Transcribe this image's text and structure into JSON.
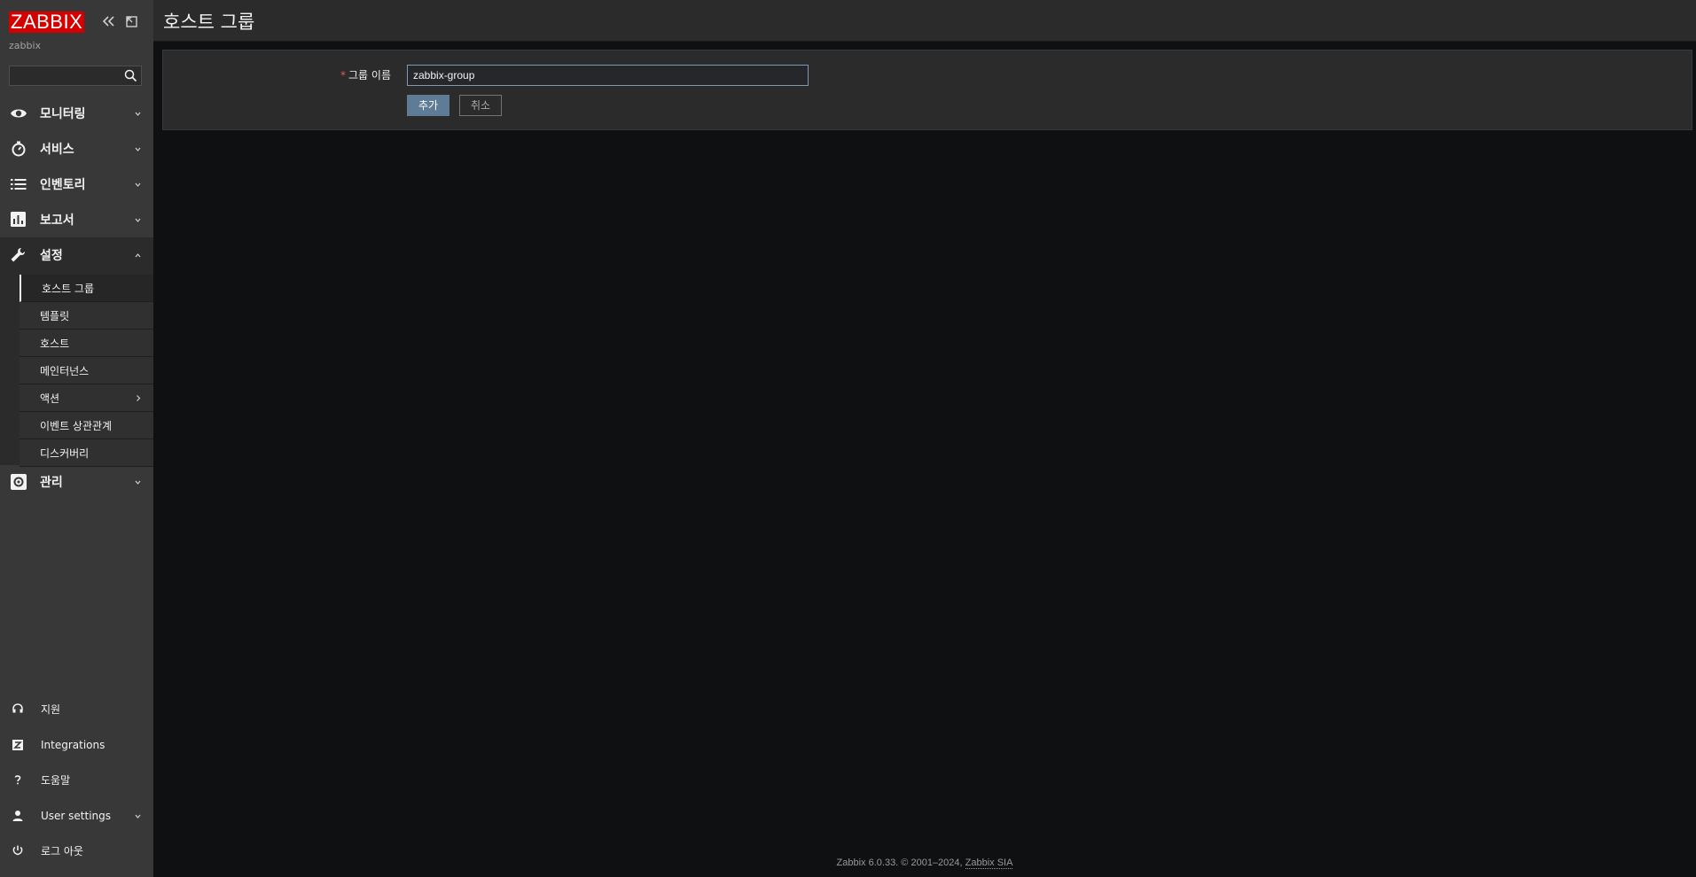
{
  "sidebar": {
    "logo_text": "ZABBIX",
    "server_name": "zabbix",
    "search_placeholder": "",
    "menu": [
      {
        "label": "모니터링",
        "icon": "eye-icon"
      },
      {
        "label": "서비스",
        "icon": "stopwatch-icon"
      },
      {
        "label": "인벤토리",
        "icon": "list-icon"
      },
      {
        "label": "보고서",
        "icon": "bar-chart-icon"
      },
      {
        "label": "설정",
        "icon": "wrench-icon"
      },
      {
        "label": "관리",
        "icon": "gear-icon"
      }
    ],
    "submenu": [
      {
        "label": "호스트 그룹"
      },
      {
        "label": "템플릿"
      },
      {
        "label": "호스트"
      },
      {
        "label": "메인터넌스"
      },
      {
        "label": "액션"
      },
      {
        "label": "이벤트 상관관계"
      },
      {
        "label": "디스커버리"
      }
    ],
    "bottom": [
      {
        "label": "지원",
        "icon": "headset-icon"
      },
      {
        "label": "Integrations",
        "icon": "integrations-icon"
      },
      {
        "label": "도움말",
        "icon": "question-icon"
      },
      {
        "label": "User settings",
        "icon": "user-icon"
      },
      {
        "label": "로그 아웃",
        "icon": "power-icon"
      }
    ]
  },
  "header": {
    "title": "호스트 그룹"
  },
  "form": {
    "required_marker": "*",
    "group_name_label": "그룹 이름",
    "group_name_value": "zabbix-group",
    "add_label": "추가",
    "cancel_label": "취소"
  },
  "footer": {
    "text": "Zabbix 6.0.33. © 2001–2024,",
    "link": "Zabbix SIA"
  },
  "colors": {
    "brand": "#d40000",
    "sidebar_bg": "#383838",
    "main_bg": "#0e1012",
    "primary_button": "#5f7c97"
  }
}
